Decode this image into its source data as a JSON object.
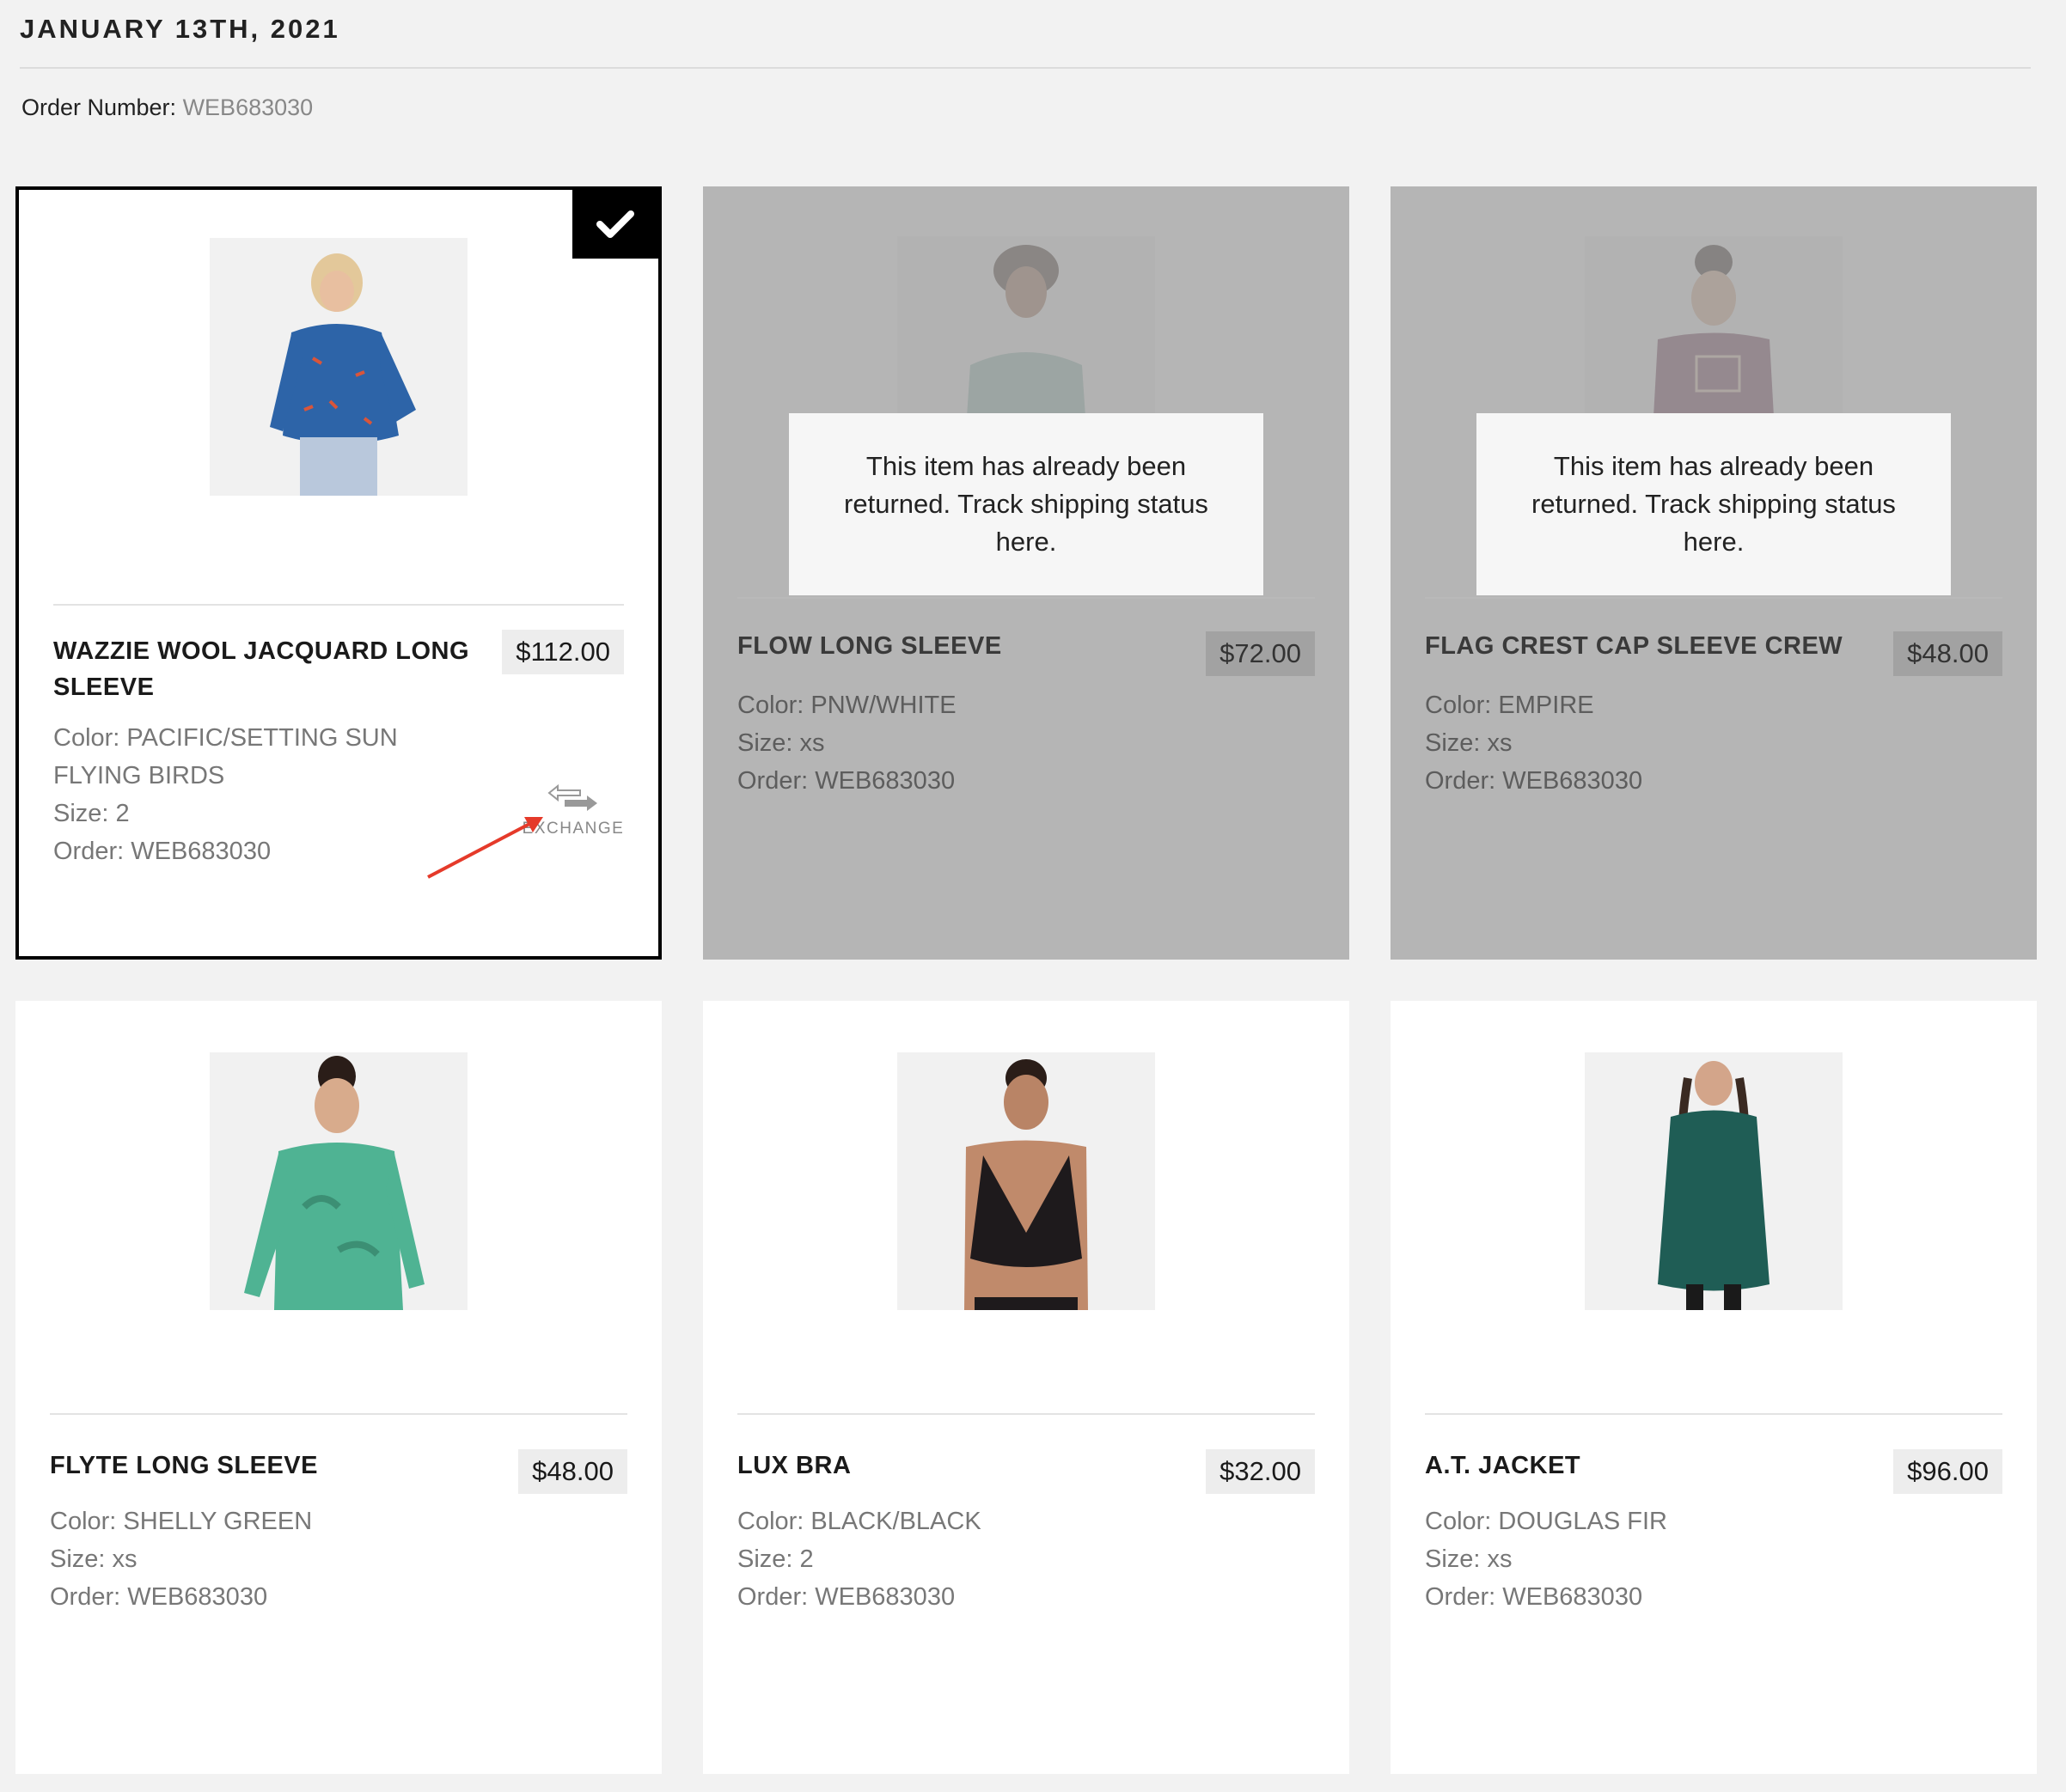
{
  "header": {
    "date": "JANUARY 13TH, 2021",
    "order_label": "Order Number: ",
    "order_value": "WEB683030"
  },
  "notice_text": "This item has already been returned. Track shipping status here.",
  "exchange_label": "EXCHANGE",
  "colors": {
    "accent": "#000000",
    "dim_overlay": "#a0a0a0",
    "annotation": "#e53a2a"
  },
  "items": [
    {
      "name": "WAZZIE WOOL JACQUARD LONG SLEEVE",
      "price": "$112.00",
      "color": "Color: PACIFIC/SETTING SUN FLYING BIRDS",
      "size": "Size: 2",
      "order": "Order: WEB683030",
      "state": "selected"
    },
    {
      "name": "FLOW LONG SLEEVE",
      "price": "$72.00",
      "color": "Color: PNW/WHITE",
      "size": "Size: xs",
      "order": "Order: WEB683030",
      "state": "returned"
    },
    {
      "name": "FLAG CREST CAP SLEEVE CREW",
      "price": "$48.00",
      "color": "Color: EMPIRE",
      "size": "Size: xs",
      "order": "Order: WEB683030",
      "state": "returned"
    },
    {
      "name": "FLYTE LONG SLEEVE",
      "price": "$48.00",
      "color": "Color: SHELLY GREEN",
      "size": "Size: xs",
      "order": "Order: WEB683030",
      "state": "available"
    },
    {
      "name": "LUX BRA",
      "price": "$32.00",
      "color": "Color: BLACK/BLACK",
      "size": "Size: 2",
      "order": "Order: WEB683030",
      "state": "available"
    },
    {
      "name": "A.T. JACKET",
      "price": "$96.00",
      "color": "Color: DOUGLAS FIR",
      "size": "Size: xs",
      "order": "Order: WEB683030",
      "state": "available"
    }
  ]
}
